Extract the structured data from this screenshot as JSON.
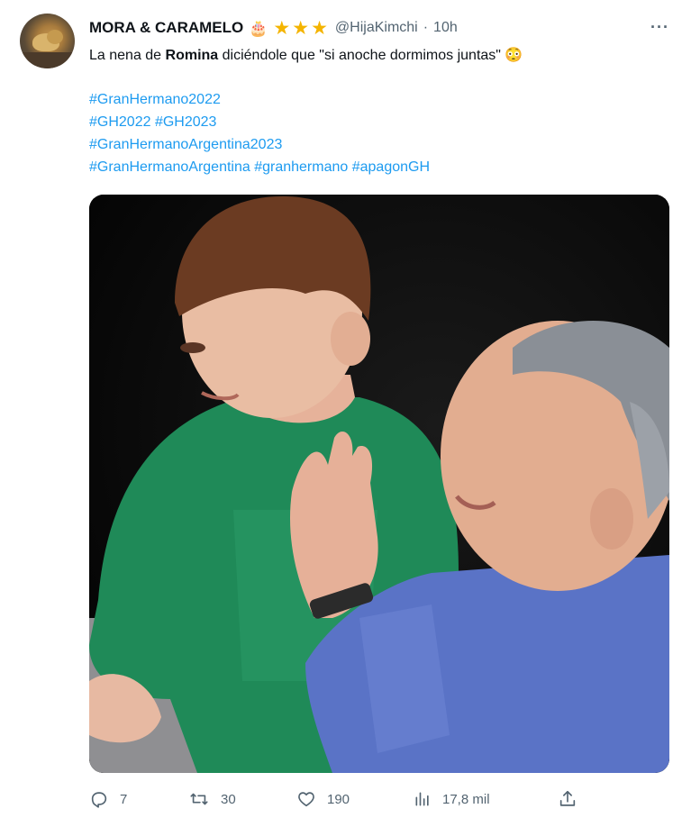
{
  "tweet": {
    "author_name": "MORA & CARAMELO",
    "badge_emoji": "🎂",
    "handle": "@HijaKimchi",
    "separator": "·",
    "time": "10h",
    "more": "···",
    "text_before": "La nena de ",
    "text_bold": "Romina",
    "text_after": " diciéndole que \"si anoche dormimos juntas\"",
    "text_emoji": "😳",
    "hashtag_lines": [
      "#GranHermano2022",
      "#GH2022 #GH2023",
      "#GranHermanoArgentina2023",
      "#GranHermanoArgentina #granhermano #apagonGH"
    ]
  },
  "actions": {
    "replies": "7",
    "retweets": "30",
    "likes": "190",
    "views": "17,8 mil"
  },
  "icons": {
    "stars": [
      "star-icon",
      "star-icon",
      "star-icon"
    ],
    "reply": "reply-icon",
    "retweet": "retweet-icon",
    "like": "heart-icon",
    "views": "views-icon",
    "share": "share-icon"
  },
  "colors": {
    "link": "#1d9bf0",
    "secondary_text": "#536471",
    "star": "#f4b400"
  }
}
